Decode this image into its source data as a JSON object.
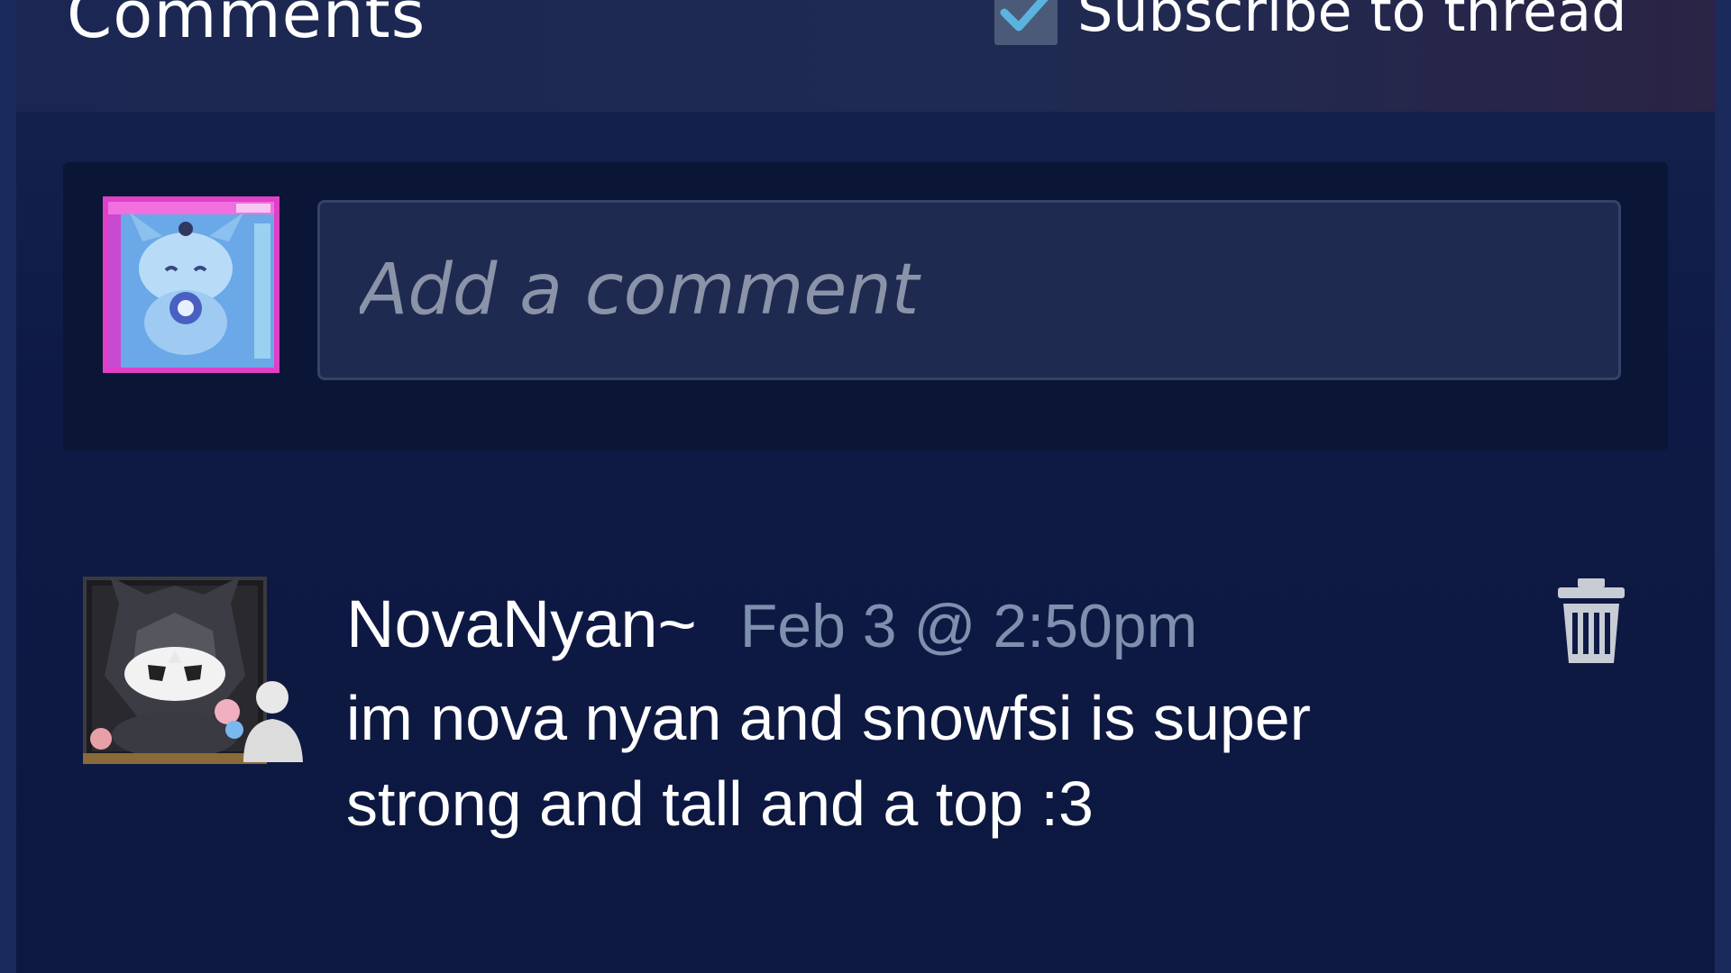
{
  "header": {
    "title": "Comments",
    "subscribe_label": "Subscribe to thread",
    "subscribe_checked": true
  },
  "composer": {
    "placeholder": "Add a comment",
    "value": ""
  },
  "comments": [
    {
      "author": "NovaNyan~",
      "timestamp": "Feb 3 @ 2:50pm",
      "text": "im nova nyan and snowfsi is super strong and tall and a top :3"
    }
  ],
  "icons": {
    "checkbox": "checkmark-icon",
    "delete": "trash-icon",
    "friend": "person-icon"
  },
  "colors": {
    "background": "#0e1a45",
    "accent_check": "#5ab4e0",
    "timestamp": "#7f8fae"
  }
}
